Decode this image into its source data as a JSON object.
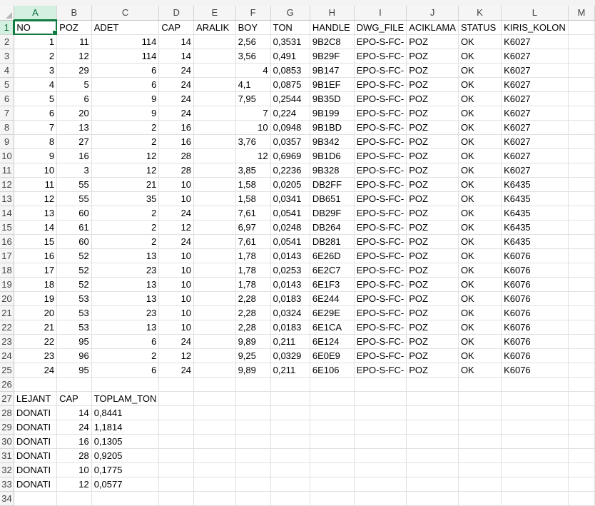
{
  "columns": [
    "A",
    "B",
    "C",
    "D",
    "E",
    "F",
    "G",
    "H",
    "I",
    "J",
    "K",
    "L",
    "M"
  ],
  "rows": [
    [
      "NO",
      "POZ",
      "ADET",
      "CAP",
      "ARALIK",
      "BOY",
      "TON",
      "HANDLE",
      "DWG_FILE",
      "ACIKLAMA",
      "STATUS",
      "KIRIS_KOLON",
      ""
    ],
    [
      "1",
      "11",
      "114",
      "14",
      "",
      "2,56",
      "0,3531",
      "9B2C8",
      "EPO-S-FC-",
      "POZ",
      "OK",
      "K6027",
      ""
    ],
    [
      "2",
      "12",
      "114",
      "14",
      "",
      "3,56",
      "0,491",
      "9B29F",
      "EPO-S-FC-",
      "POZ",
      "OK",
      "K6027",
      ""
    ],
    [
      "3",
      "29",
      "6",
      "24",
      "",
      "4",
      "0,0853",
      "9B147",
      "EPO-S-FC-",
      "POZ",
      "OK",
      "K6027",
      ""
    ],
    [
      "4",
      "5",
      "6",
      "24",
      "",
      "4,1",
      "0,0875",
      "9B1EF",
      "EPO-S-FC-",
      "POZ",
      "OK",
      "K6027",
      ""
    ],
    [
      "5",
      "6",
      "9",
      "24",
      "",
      "7,95",
      "0,2544",
      "9B35D",
      "EPO-S-FC-",
      "POZ",
      "OK",
      "K6027",
      ""
    ],
    [
      "6",
      "20",
      "9",
      "24",
      "",
      "7",
      "0,224",
      "9B199",
      "EPO-S-FC-",
      "POZ",
      "OK",
      "K6027",
      ""
    ],
    [
      "7",
      "13",
      "2",
      "16",
      "",
      "10",
      "0,0948",
      "9B1BD",
      "EPO-S-FC-",
      "POZ",
      "OK",
      "K6027",
      ""
    ],
    [
      "8",
      "27",
      "2",
      "16",
      "",
      "3,76",
      "0,0357",
      "9B342",
      "EPO-S-FC-",
      "POZ",
      "OK",
      "K6027",
      ""
    ],
    [
      "9",
      "16",
      "12",
      "28",
      "",
      "12",
      "0,6969",
      "9B1D6",
      "EPO-S-FC-",
      "POZ",
      "OK",
      "K6027",
      ""
    ],
    [
      "10",
      "3",
      "12",
      "28",
      "",
      "3,85",
      "0,2236",
      "9B328",
      "EPO-S-FC-",
      "POZ",
      "OK",
      "K6027",
      ""
    ],
    [
      "11",
      "55",
      "21",
      "10",
      "",
      "1,58",
      "0,0205",
      "DB2FF",
      "EPO-S-FC-",
      "POZ",
      "OK",
      "K6435",
      ""
    ],
    [
      "12",
      "55",
      "35",
      "10",
      "",
      "1,58",
      "0,0341",
      "DB651",
      "EPO-S-FC-",
      "POZ",
      "OK",
      "K6435",
      ""
    ],
    [
      "13",
      "60",
      "2",
      "24",
      "",
      "7,61",
      "0,0541",
      "DB29F",
      "EPO-S-FC-",
      "POZ",
      "OK",
      "K6435",
      ""
    ],
    [
      "14",
      "61",
      "2",
      "12",
      "",
      "6,97",
      "0,0248",
      "DB264",
      "EPO-S-FC-",
      "POZ",
      "OK",
      "K6435",
      ""
    ],
    [
      "15",
      "60",
      "2",
      "24",
      "",
      "7,61",
      "0,0541",
      "DB281",
      "EPO-S-FC-",
      "POZ",
      "OK",
      "K6435",
      ""
    ],
    [
      "16",
      "52",
      "13",
      "10",
      "",
      "1,78",
      "0,0143",
      "6E26D",
      "EPO-S-FC-",
      "POZ",
      "OK",
      "K6076",
      ""
    ],
    [
      "17",
      "52",
      "23",
      "10",
      "",
      "1,78",
      "0,0253",
      "6E2C7",
      "EPO-S-FC-",
      "POZ",
      "OK",
      "K6076",
      ""
    ],
    [
      "18",
      "52",
      "13",
      "10",
      "",
      "1,78",
      "0,0143",
      "6E1F3",
      "EPO-S-FC-",
      "POZ",
      "OK",
      "K6076",
      ""
    ],
    [
      "19",
      "53",
      "13",
      "10",
      "",
      "2,28",
      "0,0183",
      "6E244",
      "EPO-S-FC-",
      "POZ",
      "OK",
      "K6076",
      ""
    ],
    [
      "20",
      "53",
      "23",
      "10",
      "",
      "2,28",
      "0,0324",
      "6E29E",
      "EPO-S-FC-",
      "POZ",
      "OK",
      "K6076",
      ""
    ],
    [
      "21",
      "53",
      "13",
      "10",
      "",
      "2,28",
      "0,0183",
      "6E1CA",
      "EPO-S-FC-",
      "POZ",
      "OK",
      "K6076",
      ""
    ],
    [
      "22",
      "95",
      "6",
      "24",
      "",
      "9,89",
      "0,211",
      "6E124",
      "EPO-S-FC-",
      "POZ",
      "OK",
      "K6076",
      ""
    ],
    [
      "23",
      "96",
      "2",
      "12",
      "",
      "9,25",
      "0,0329",
      "6E0E9",
      "EPO-S-FC-",
      "POZ",
      "OK",
      "K6076",
      ""
    ],
    [
      "24",
      "95",
      "6",
      "24",
      "",
      "9,89",
      "0,211",
      "6E106",
      "EPO-S-FC-",
      "POZ",
      "OK",
      "K6076",
      ""
    ],
    [
      "",
      "",
      "",
      "",
      "",
      "",
      "",
      "",
      "",
      "",
      "",
      "",
      ""
    ],
    [
      "LEJANT",
      "CAP",
      "TOPLAM_TON",
      "",
      "",
      "",
      "",
      "",
      "",
      "",
      "",
      "",
      ""
    ],
    [
      "DONATI",
      "14",
      "0,8441",
      "",
      "",
      "",
      "",
      "",
      "",
      "",
      "",
      "",
      ""
    ],
    [
      "DONATI",
      "24",
      "1,1814",
      "",
      "",
      "",
      "",
      "",
      "",
      "",
      "",
      "",
      ""
    ],
    [
      "DONATI",
      "16",
      "0,1305",
      "",
      "",
      "",
      "",
      "",
      "",
      "",
      "",
      "",
      ""
    ],
    [
      "DONATI",
      "28",
      "0,9205",
      "",
      "",
      "",
      "",
      "",
      "",
      "",
      "",
      "",
      ""
    ],
    [
      "DONATI",
      "10",
      "0,1775",
      "",
      "",
      "",
      "",
      "",
      "",
      "",
      "",
      "",
      ""
    ],
    [
      "DONATI",
      "12",
      "0,0577",
      "",
      "",
      "",
      "",
      "",
      "",
      "",
      "",
      "",
      ""
    ],
    [
      "",
      "",
      "",
      "",
      "",
      "",
      "",
      "",
      "",
      "",
      "",
      "",
      ""
    ]
  ],
  "active_cell": "A1",
  "accent_color": "#107c41"
}
